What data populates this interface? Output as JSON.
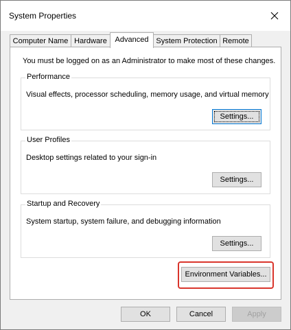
{
  "window": {
    "title": "System Properties"
  },
  "tabs": [
    {
      "label": "Computer Name",
      "active": false
    },
    {
      "label": "Hardware",
      "active": false
    },
    {
      "label": "Advanced",
      "active": true
    },
    {
      "label": "System Protection",
      "active": false
    },
    {
      "label": "Remote",
      "active": false
    }
  ],
  "advanced": {
    "admin_note": "You must be logged on as an Administrator to make most of these changes.",
    "performance": {
      "title": "Performance",
      "description": "Visual effects, processor scheduling, memory usage, and virtual memory",
      "button_label": "Settings..."
    },
    "user_profiles": {
      "title": "User Profiles",
      "description": "Desktop settings related to your sign-in",
      "button_label": "Settings..."
    },
    "startup_recovery": {
      "title": "Startup and Recovery",
      "description": "System startup, system failure, and debugging information",
      "button_label": "Settings..."
    },
    "env_vars_label": "Environment Variables..."
  },
  "footer": {
    "ok": "OK",
    "cancel": "Cancel",
    "apply": "Apply"
  },
  "colors": {
    "highlight": "#d9342b",
    "focus": "#0078d7"
  }
}
